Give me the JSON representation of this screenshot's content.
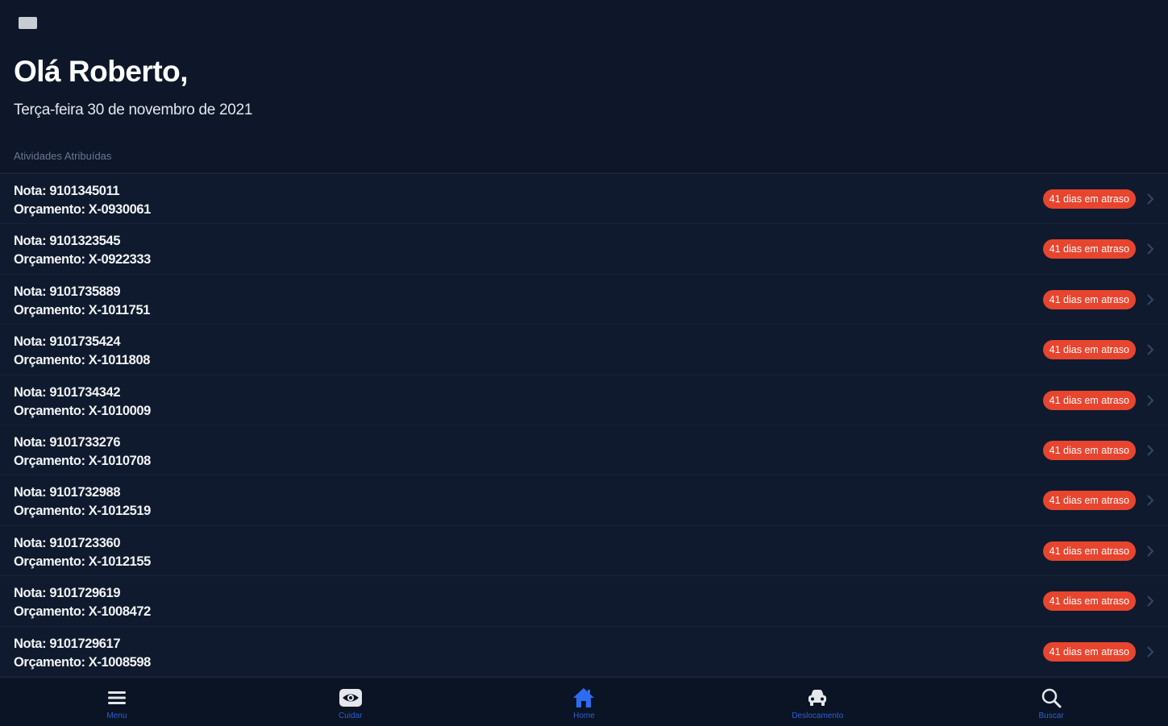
{
  "header": {
    "greeting": "Olá Roberto,",
    "date": "Terça-feira 30 de novembro de 2021",
    "section_label": "Atividades Atribuídas"
  },
  "activities": [
    {
      "nota": "Nota: 9101345011",
      "orcamento": "Orçamento: X-0930061",
      "badge": "41 dias em atraso"
    },
    {
      "nota": "Nota: 9101323545",
      "orcamento": "Orçamento: X-0922333",
      "badge": "41 dias em atraso"
    },
    {
      "nota": "Nota: 9101735889",
      "orcamento": "Orçamento: X-1011751",
      "badge": "41 dias em atraso"
    },
    {
      "nota": "Nota: 9101735424",
      "orcamento": "Orçamento: X-1011808",
      "badge": "41 dias em atraso"
    },
    {
      "nota": "Nota: 9101734342",
      "orcamento": "Orçamento: X-1010009",
      "badge": "41 dias em atraso"
    },
    {
      "nota": "Nota: 9101733276",
      "orcamento": "Orçamento: X-1010708",
      "badge": "41 dias em atraso"
    },
    {
      "nota": "Nota: 9101732988",
      "orcamento": "Orçamento: X-1012519",
      "badge": "41 dias em atraso"
    },
    {
      "nota": "Nota: 9101723360",
      "orcamento": "Orçamento: X-1012155",
      "badge": "41 dias em atraso"
    },
    {
      "nota": "Nota: 9101729619",
      "orcamento": "Orçamento: X-1008472",
      "badge": "41 dias em atraso"
    },
    {
      "nota": "Nota: 9101729617",
      "orcamento": "Orçamento: X-1008598",
      "badge": "41 dias em atraso"
    }
  ],
  "tabs": [
    {
      "label": "Menu",
      "icon": "hamburger-icon"
    },
    {
      "label": "Cuidar",
      "icon": "eye-icon"
    },
    {
      "label": "Home",
      "icon": "home-icon"
    },
    {
      "label": "Deslocamento",
      "icon": "car-icon"
    },
    {
      "label": "Buscar",
      "icon": "search-icon"
    }
  ],
  "colors": {
    "background": "#0f1a2e",
    "badge": "#e8452f",
    "tab_active": "#2d6cf0",
    "tab_label": "#2d5fd6"
  }
}
